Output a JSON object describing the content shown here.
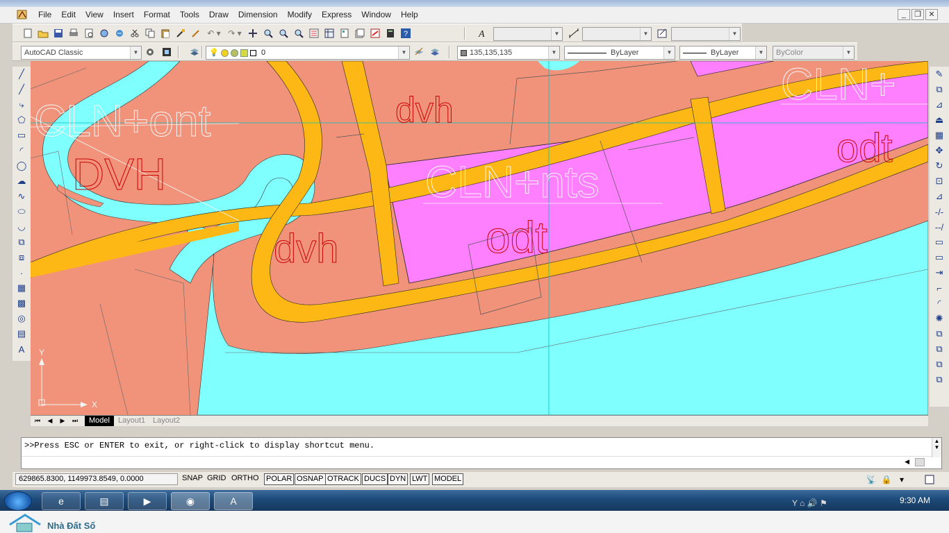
{
  "menu": [
    "File",
    "Edit",
    "View",
    "Insert",
    "Format",
    "Tools",
    "Draw",
    "Dimension",
    "Modify",
    "Express",
    "Window",
    "Help"
  ],
  "window_buttons": [
    "_",
    "❐",
    "✕"
  ],
  "workspace": "AutoCAD Classic",
  "layer": "0",
  "color": "135,135,135",
  "linetype": "ByLayer",
  "lineweight": "ByLayer",
  "plotstyle": "ByColor",
  "drawing_labels": {
    "dvh_top": "dvh",
    "DVH": "DVH",
    "cln_ont": "CLN+ont",
    "cln_nts": "CLN+nts",
    "odt_center": "odt",
    "dvh_mid": "dvh",
    "cln_right": "CLN+",
    "odt_right": "odt"
  },
  "ucs": {
    "x": "X",
    "y": "Y"
  },
  "layout_tabs": [
    "Model",
    "Layout1",
    "Layout2"
  ],
  "command_line": ">>Press ESC or ENTER to exit, or right-click to display shortcut menu.",
  "coordinates": "629865.8300, 1149973.8549, 0.0000",
  "status_buttons": [
    {
      "label": "SNAP",
      "on": false
    },
    {
      "label": "GRID",
      "on": false
    },
    {
      "label": "ORTHO",
      "on": false
    },
    {
      "label": "POLAR",
      "on": true
    },
    {
      "label": "OSNAP",
      "on": true
    },
    {
      "label": "OTRACK",
      "on": true
    },
    {
      "label": "DUCS",
      "on": true
    },
    {
      "label": "DYN",
      "on": true
    },
    {
      "label": "LWT",
      "on": true
    },
    {
      "label": "MODEL",
      "on": true
    }
  ],
  "clock": "9:30 AM",
  "watermark": "Nhà Đất Số",
  "colors": {
    "land_salmon": "#f1937b",
    "road_orange": "#fdb815",
    "residential_magenta": "#ff80ff",
    "water_cyan": "#80ffff",
    "label_red": "#cc0000",
    "label_white": "#f4f4f4"
  }
}
